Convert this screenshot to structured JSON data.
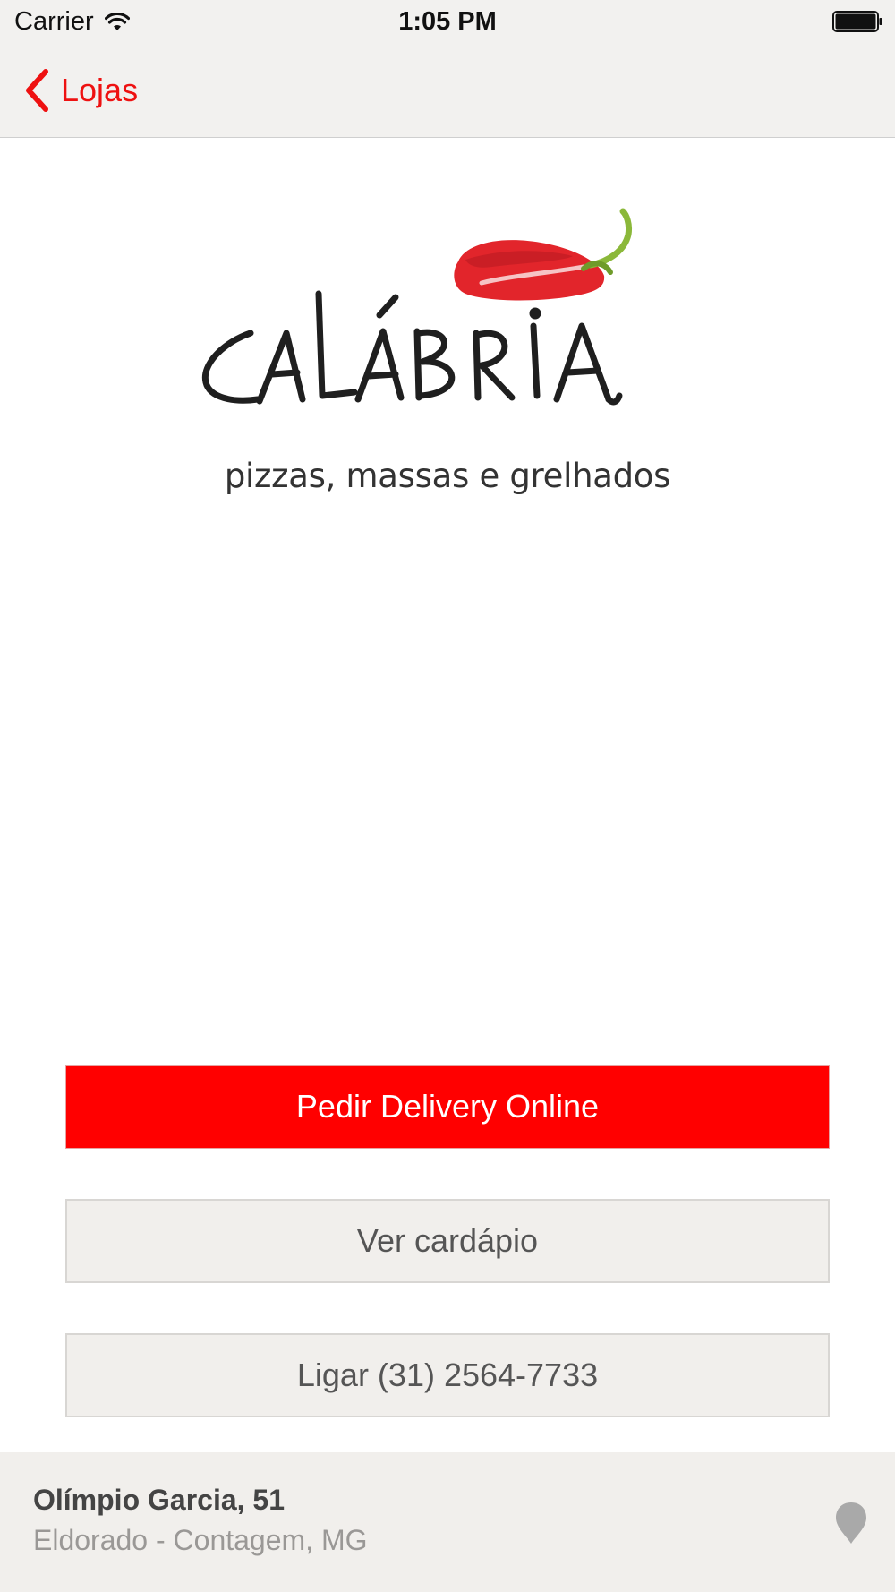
{
  "status_bar": {
    "carrier": "Carrier",
    "time": "1:05 PM"
  },
  "nav": {
    "back_label": "Lojas"
  },
  "logo": {
    "brand": "CALÁBRIA",
    "tagline": "pizzas, massas e grelhados"
  },
  "actions": {
    "delivery_label": "Pedir Delivery Online",
    "menu_label": "Ver cardápio",
    "call_label": "Ligar (31) 2564-7733"
  },
  "address": {
    "street": "Olímpio Garcia, 51",
    "city": "Eldorado - Contagem, MG"
  },
  "colors": {
    "accent": "#ff0000",
    "nav_background": "#f2f1ef",
    "button_secondary": "#f1efec"
  },
  "icons": {
    "back": "chevron-left-icon",
    "wifi": "wifi-icon",
    "battery": "battery-icon",
    "location": "map-pin-icon"
  }
}
